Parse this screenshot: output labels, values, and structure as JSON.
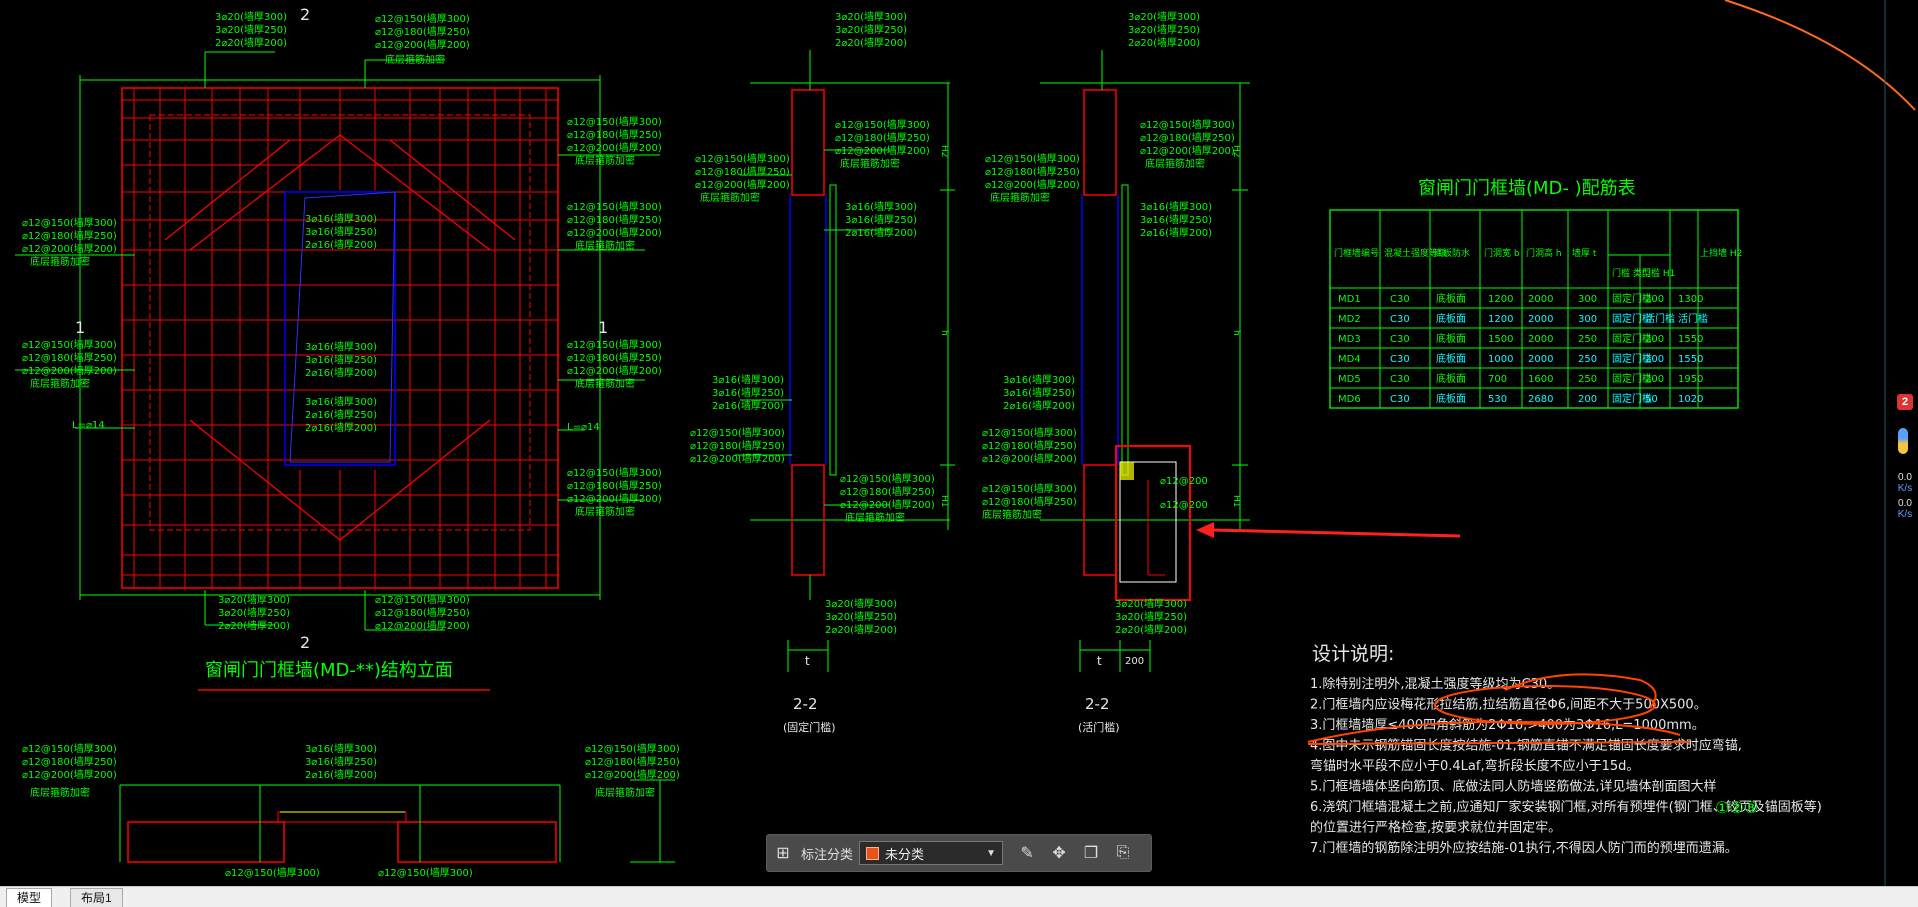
{
  "tabs": [
    {
      "label": "模型"
    },
    {
      "label": "布局1"
    }
  ],
  "toolbar": {
    "label": "标注分类",
    "selected": "未分类",
    "swatch_color": "#e8531b",
    "icons": [
      "grid-icon",
      "edit-icon",
      "move-icon",
      "copy-icon",
      "paste-icon"
    ]
  },
  "side_widget": {
    "badge": "2",
    "rate_up": "0.0",
    "rate_down": "0.0",
    "unit": "K/s"
  },
  "drawing": {
    "elev_title": "窗闸门门框墙(MD-**)结构立面",
    "section_mark_top": "2",
    "section_mark_bottom": "2",
    "side_mark_left": "1",
    "side_mark_right": "1",
    "top_rebar": [
      "3⌀20(墙厚300)",
      "3⌀20(墙厚250)",
      "2⌀20(墙厚200)"
    ],
    "top_rebar_right": [
      "⌀12@150(墙厚300)",
      "⌀12@180(墙厚250)",
      "⌀12@200(墙厚200)",
      "底层箍筋加密"
    ],
    "left_rebar": [
      "⌀12@150(墙厚300)",
      "⌀12@180(墙厚250)",
      "⌀12@200(墙厚200)",
      "底层箍筋加密"
    ],
    "mid_rebar": [
      "3⌀16(墙厚300)",
      "3⌀16(墙厚250)",
      "2⌀16(墙厚200)"
    ],
    "dim_l": "L=⌀14",
    "sec1_label": "2-2",
    "sec1_sub": "(固定门槛)",
    "sec2_label": "2-2",
    "sec2_sub": "(活门槛)",
    "dim_t": "t",
    "dim_200": "200",
    "dim_h": "h",
    "dim_h1": "H1",
    "dim_h2": "H2"
  },
  "table": {
    "title": "窗闸门门框墙(MD- )配筋表",
    "headers": [
      "门框墙编号",
      "混凝土强度等级",
      "底板防水",
      "门洞宽 b",
      "门洞高 h",
      "墙厚 t",
      "门槛 类型",
      "门槛 H1",
      "上挡墙 H2"
    ],
    "rows": [
      [
        "MD1",
        "C30",
        "底板面",
        "1200",
        "2000",
        "300",
        "固定门槛",
        "200",
        "1300"
      ],
      [
        "MD2",
        "C30",
        "底板面",
        "1200",
        "2000",
        "300",
        "固定门槛",
        "活门槛",
        "活门槛"
      ],
      [
        "MD3",
        "C30",
        "底板面",
        "1500",
        "2000",
        "250",
        "固定门槛",
        "200",
        "1550"
      ],
      [
        "MD4",
        "C30",
        "底板面",
        "1000",
        "2000",
        "250",
        "固定门槛",
        "200",
        "1550"
      ],
      [
        "MD5",
        "C30",
        "底板面",
        "700",
        "1600",
        "250",
        "固定门槛",
        "200",
        "1950"
      ],
      [
        "MD6",
        "C30",
        "底板面",
        "530",
        "2680",
        "200",
        "固定门槛",
        "50",
        "1020"
      ]
    ]
  },
  "notes": {
    "title": "设计说明:",
    "items": [
      "1.除特别注明外,混凝土强度等级均为C30。",
      "2.门框墙内应设梅花形拉结筋,拉结筋直径Φ6,间距不大于500X500。",
      "3.门框墙墙厚≤400四角斜筋为2Φ16,>400为3Φ16,L=1000mm。",
      "4.图中未示钢筋锚固长度按结施-01,钢筋直锚不满足锚固长度要求时应弯锚,",
      "   弯锚时水平段不应小于0.4Laf,弯折段长度不应小于15d。",
      "5.门框墙墙体竖向筋顶、底做法同人防墙竖筋做法,详见墙体剖面图大样",
      "6.浇筑门框墙混凝土之前,应通知厂家安装钢门框,对所有预埋件(钢门框、铰页及锚固板等)",
      "   的位置进行严格检查,按要求就位并固定牢。",
      "7.门框墙的钢筋除注明外应按结施-01执行,不得因人防门而的预埋而遗漏。"
    ],
    "circled": "①②③"
  }
}
